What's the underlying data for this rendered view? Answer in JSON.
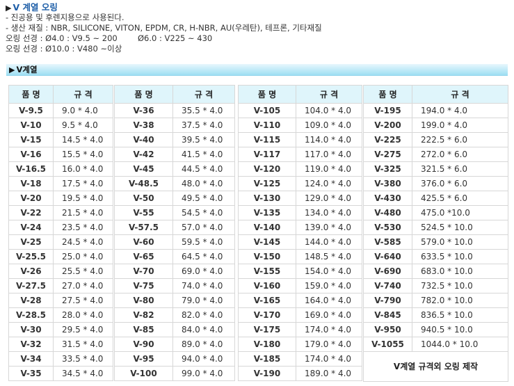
{
  "intro": {
    "title": "V 계열 오링",
    "lines": [
      "- 진공용 및 후렌지용으로 사용된다.",
      "- 생산 재질 : NBR, SILICONE, VITON, EPDM, CR, H-NBR, AU(우레탄), 테프론, 기타재질",
      "오링 선경 : Ø4.0 : V9.5 ~ 200        Ø6.0 : V225 ~ 430",
      "오링 선경 : Ø10.0 : V480 ~이상"
    ]
  },
  "section_title": "V계열",
  "table_headers": {
    "name": "품 명",
    "size": "규 격"
  },
  "tables": [
    {
      "rows": [
        [
          "V-9.5",
          "9.0 * 4.0"
        ],
        [
          "V-10",
          "9.5 * 4.0"
        ],
        [
          "V-15",
          "14.5 * 4.0"
        ],
        [
          "V-16",
          "15.5 * 4.0"
        ],
        [
          "V-16.5",
          "16.0 * 4.0"
        ],
        [
          "V-18",
          "17.5 * 4.0"
        ],
        [
          "V-20",
          "19.5 * 4.0"
        ],
        [
          "V-22",
          "21.5 * 4.0"
        ],
        [
          "V-24",
          "23.5 * 4.0"
        ],
        [
          "V-25",
          "24.5 * 4.0"
        ],
        [
          "V-25.5",
          "25.0 * 4.0"
        ],
        [
          "V-26",
          "25.5 * 4.0"
        ],
        [
          "V-27.5",
          "27.0 * 4.0"
        ],
        [
          "V-28",
          "27.5 * 4.0"
        ],
        [
          "V-28.5",
          "28.0 * 4.0"
        ],
        [
          "V-30",
          "29.5 * 4.0"
        ],
        [
          "V-32",
          "31.5 * 4.0"
        ],
        [
          "V-34",
          "33.5 * 4.0"
        ],
        [
          "V-35",
          "34.5 * 4.0"
        ]
      ]
    },
    {
      "rows": [
        [
          "V-36",
          "35.5 * 4.0"
        ],
        [
          "V-38",
          "37.5 * 4.0"
        ],
        [
          "V-40",
          "39.5 * 4.0"
        ],
        [
          "V-42",
          "41.5 * 4.0"
        ],
        [
          "V-45",
          "44.5 * 4.0"
        ],
        [
          "V-48.5",
          "48.0 * 4.0"
        ],
        [
          "V-50",
          "49.5 * 4.0"
        ],
        [
          "V-55",
          "54.5 * 4.0"
        ],
        [
          "V-57.5",
          "57.0 * 4.0"
        ],
        [
          "V-60",
          "59.5 * 4.0"
        ],
        [
          "V-65",
          "64.5 * 4.0"
        ],
        [
          "V-70",
          "69.0 * 4.0"
        ],
        [
          "V-75",
          "74.0 * 4.0"
        ],
        [
          "V-80",
          "79.0 * 4.0"
        ],
        [
          "V-82",
          "82.0 * 4.0"
        ],
        [
          "V-85",
          "84.0 * 4.0"
        ],
        [
          "V-90",
          "89.0 * 4.0"
        ],
        [
          "V-95",
          "94.0 * 4.0"
        ],
        [
          "V-100",
          "99.0 * 4.0"
        ]
      ]
    },
    {
      "rows": [
        [
          "V-105",
          "104.0 * 4.0"
        ],
        [
          "V-110",
          "109.0 * 4.0"
        ],
        [
          "V-115",
          "114.0 * 4.0"
        ],
        [
          "V-117",
          "117.0 * 4.0"
        ],
        [
          "V-120",
          "119.0 * 4.0"
        ],
        [
          "V-125",
          "124.0 * 4.0"
        ],
        [
          "V-130",
          "129.0 * 4.0"
        ],
        [
          "V-135",
          "134.0 * 4.0"
        ],
        [
          "V-140",
          "139.0 * 4.0"
        ],
        [
          "V-145",
          "144.0 * 4.0"
        ],
        [
          "V-150",
          "148.5 * 4.0"
        ],
        [
          "V-155",
          "154.0 * 4.0"
        ],
        [
          "V-160",
          "159.0 * 4.0"
        ],
        [
          "V-165",
          "164.0 * 4.0"
        ],
        [
          "V-170",
          "169.0 * 4.0"
        ],
        [
          "V-175",
          "174.0 * 4.0"
        ],
        [
          "V-180",
          "179.0 * 4.0"
        ],
        [
          "V-185",
          "174.0 * 4.0"
        ],
        [
          "V-190",
          "189.0 * 4.0"
        ]
      ]
    },
    {
      "rows": [
        [
          "V-195",
          "194.0 * 4.0"
        ],
        [
          "V-200",
          "199.0 * 4.0"
        ],
        [
          "V-225",
          "222.5 * 6.0"
        ],
        [
          "V-275",
          "272.0 * 6.0"
        ],
        [
          "V-325",
          "321.5 * 6.0"
        ],
        [
          "V-380",
          "376.0 * 6.0"
        ],
        [
          "V-430",
          "425.5 * 6.0"
        ],
        [
          "V-480",
          "475.0 *10.0"
        ],
        [
          "V-530",
          "524.5 * 10.0"
        ],
        [
          "V-585",
          "579.0 * 10.0"
        ],
        [
          "V-640",
          "633.5 * 10.0"
        ],
        [
          "V-690",
          "683.0 * 10.0"
        ],
        [
          "V-740",
          "732.5 * 10.0"
        ],
        [
          "V-790",
          "782.0 * 10.0"
        ],
        [
          "V-845",
          "836.5 * 10.0"
        ],
        [
          "V-950",
          "940.5 * 10.0"
        ],
        [
          "V-1055",
          "1044.0 * 10.0"
        ]
      ],
      "note": "V계열 규격외 오링 제작"
    }
  ]
}
